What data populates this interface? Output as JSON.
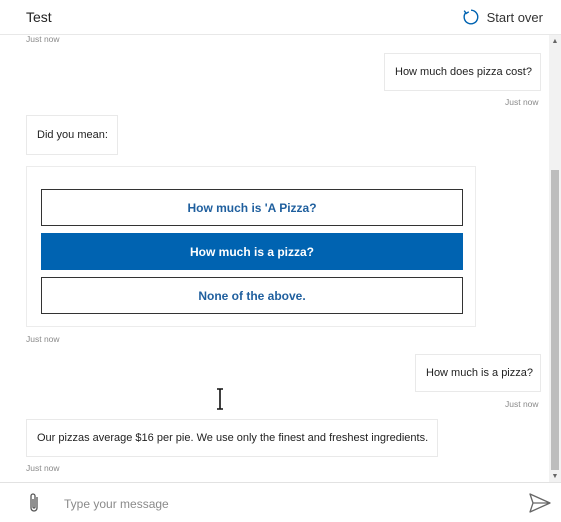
{
  "header": {
    "title": "Test",
    "start_over_label": "Start over",
    "start_over_icon": "refresh-icon"
  },
  "messages": [
    {
      "role": "bot",
      "timestamp": "Just now"
    },
    {
      "role": "user",
      "text": "How much does pizza cost?",
      "timestamp": "Just now"
    },
    {
      "role": "bot",
      "text": "Did you mean:"
    },
    {
      "role": "bot-card",
      "timestamp": "Just now",
      "options": [
        {
          "label": "How much is 'A Pizza?",
          "selected": false
        },
        {
          "label": "How much is a pizza?",
          "selected": true
        },
        {
          "label": "None of the above.",
          "selected": false
        }
      ]
    },
    {
      "role": "user",
      "text": "How much is a pizza?",
      "timestamp": "Just now"
    },
    {
      "role": "bot",
      "text": "Our pizzas average $16 per pie. We use only the finest and freshest ingredients.",
      "timestamp": "Just now"
    }
  ],
  "input": {
    "placeholder": "Type your message",
    "value": ""
  },
  "colors": {
    "accent": "#0063b1",
    "link_text": "#1f5f9e",
    "timestamp": "#8a8a8a"
  }
}
